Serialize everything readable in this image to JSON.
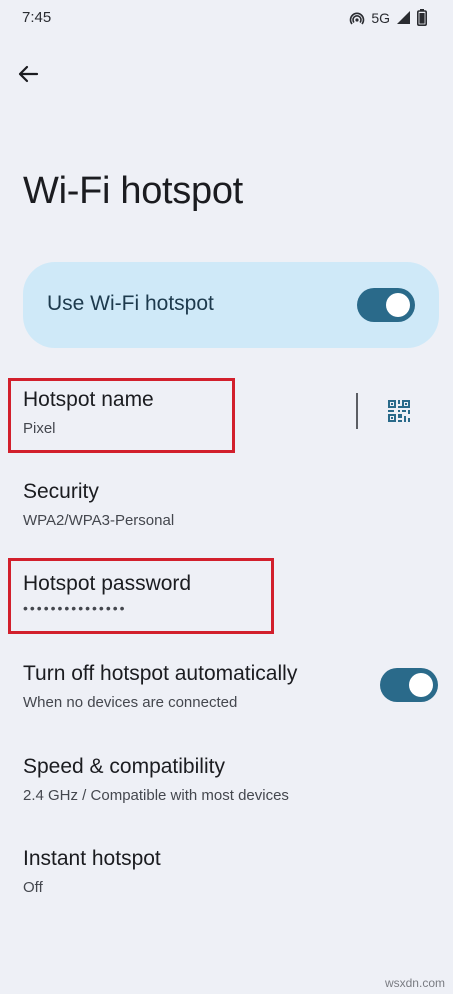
{
  "status_bar": {
    "time": "7:45",
    "network": "5G",
    "icons": [
      "hotspot-icon",
      "signal-icon",
      "battery-icon"
    ]
  },
  "header": {
    "back_icon": "arrow-back-icon",
    "title": "Wi-Fi hotspot"
  },
  "master_toggle": {
    "label": "Use Wi-Fi hotspot",
    "state": true
  },
  "items": [
    {
      "title": "Hotspot name",
      "subtitle": "Pixel",
      "trailing_icon": "qr-code-icon"
    },
    {
      "title": "Security",
      "subtitle": "WPA2/WPA3-Personal"
    },
    {
      "title": "Hotspot password",
      "subtitle": "•••••••••••••••"
    },
    {
      "title": "Turn off hotspot automatically",
      "subtitle": "When no devices are connected",
      "toggle": true
    },
    {
      "title": "Speed & compatibility",
      "subtitle": "2.4 GHz / Compatible with most devices"
    },
    {
      "title": "Instant hotspot",
      "subtitle": "Off"
    }
  ],
  "colors": {
    "background": "#eef0f6",
    "card": "#cfe9f8",
    "switch_on": "#2a6a8a",
    "highlight": "#d21f2c"
  },
  "watermark": "wsxdn.com"
}
